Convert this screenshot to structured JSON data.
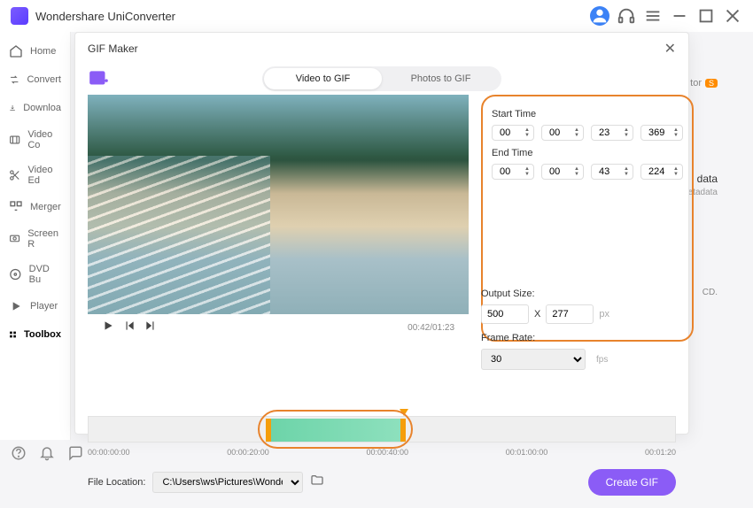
{
  "app": {
    "title": "Wondershare UniConverter"
  },
  "sidebar": {
    "items": [
      {
        "label": "Home"
      },
      {
        "label": "Convert"
      },
      {
        "label": "Downloa"
      },
      {
        "label": "Video Co"
      },
      {
        "label": "Video Ed"
      },
      {
        "label": "Merger"
      },
      {
        "label": "Screen R"
      },
      {
        "label": "DVD Bu"
      },
      {
        "label": "Player"
      },
      {
        "label": "Toolbox"
      }
    ]
  },
  "backdrop": {
    "tor": "tor",
    "s": "S",
    "data": "data",
    "etadata": "etadata",
    "cd": "CD."
  },
  "modal": {
    "title": "GIF Maker",
    "tabs": {
      "video": "Video to GIF",
      "photos": "Photos to GIF"
    },
    "startTime": {
      "label": "Start Time",
      "h": "00",
      "m": "00",
      "s": "23",
      "ms": "369"
    },
    "endTime": {
      "label": "End Time",
      "h": "00",
      "m": "00",
      "s": "43",
      "ms": "224"
    },
    "outputSize": {
      "label": "Output Size:",
      "w": "500",
      "x": "X",
      "h": "277",
      "unit": "px"
    },
    "frameRate": {
      "label": "Frame Rate:",
      "value": "30",
      "unit": "fps"
    },
    "timeReadout": "00:42/01:23",
    "ticks": [
      "00:00:00:00",
      "00:00:20:00",
      "00:00:40:00",
      "00:01:00:00",
      "00:01:20"
    ],
    "fileLocationLabel": "File Location:",
    "fileLocation": "C:\\Users\\ws\\Pictures\\Wonders",
    "createBtn": "Create GIF"
  }
}
